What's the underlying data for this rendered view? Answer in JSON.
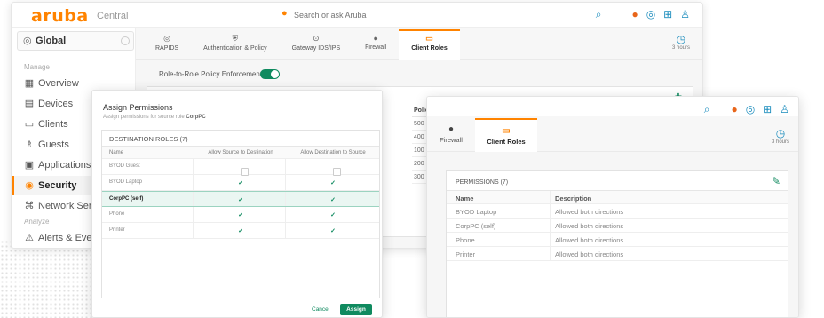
{
  "brand": {
    "logo": "aruba",
    "product": "Central"
  },
  "topbar": {
    "search_placeholder": "Search or ask Aruba"
  },
  "sidebar": {
    "scope_label": "Global",
    "section_manage": "Manage",
    "section_analyze": "Analyze",
    "items": [
      {
        "label": "Overview",
        "icon": "overview-icon"
      },
      {
        "label": "Devices",
        "icon": "devices-icon"
      },
      {
        "label": "Clients",
        "icon": "clients-icon"
      },
      {
        "label": "Guests",
        "icon": "guests-icon"
      },
      {
        "label": "Applications",
        "icon": "applications-icon"
      },
      {
        "label": "Security",
        "icon": "security-icon"
      },
      {
        "label": "Network Services",
        "icon": "network-services-icon"
      },
      {
        "label": "Alerts & Events",
        "icon": "alerts-icon"
      }
    ]
  },
  "tabs": [
    {
      "label": "RAPIDS"
    },
    {
      "label": "Authentication & Policy"
    },
    {
      "label": "Gateway IDS/IPS"
    },
    {
      "label": "Firewall"
    },
    {
      "label": "Client Roles"
    }
  ],
  "history_label": "3 hours",
  "main": {
    "enforcement_label": "Role-to-Role Policy Enforcement",
    "policy_header": "Policy Id...",
    "policy_ids": [
      "500",
      "400",
      "100",
      "200",
      "300"
    ]
  },
  "dialog": {
    "title": "Assign Permissions",
    "subtitle_prefix": "Assign permissions for source role",
    "subtitle_role": "CorpPC",
    "table_caption": "DESTINATION ROLES (7)",
    "columns": [
      "Name",
      "Allow Source to Destination",
      "Allow Destination to Source"
    ],
    "rows": [
      {
        "name": "BYOD Guest"
      },
      {
        "name": "BYOD Laptop"
      },
      {
        "name": "CorpPC (self)"
      },
      {
        "name": "Phone"
      },
      {
        "name": "Printer"
      }
    ],
    "cancel_label": "Cancel",
    "assign_label": "Assign"
  },
  "roles_window": {
    "tabs": [
      {
        "label": "Firewall"
      },
      {
        "label": "Client Roles"
      }
    ],
    "history_label": "3 hours",
    "permissions_caption": "PERMISSIONS (7)",
    "columns": [
      "Name",
      "Description"
    ],
    "rows": [
      {
        "name": "BYOD Laptop",
        "description": "Allowed both directions"
      },
      {
        "name": "CorpPC (self)",
        "description": "Allowed both directions"
      },
      {
        "name": "Phone",
        "description": "Allowed both directions"
      },
      {
        "name": "Printer",
        "description": "Allowed both directions"
      }
    ]
  },
  "colors": {
    "brand_orange": "#ff8300",
    "accent_green": "#0f8a5f",
    "link_blue": "#1a8cbd"
  }
}
